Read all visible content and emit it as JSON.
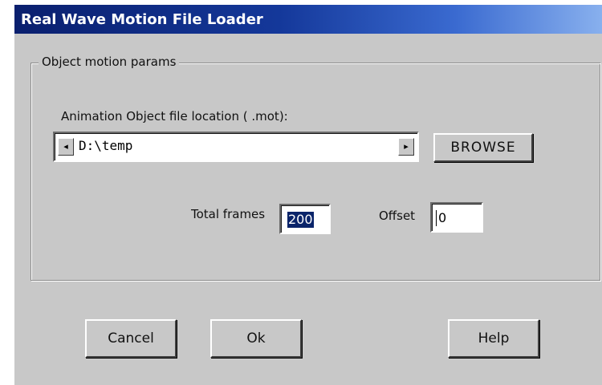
{
  "window": {
    "title": "Real Wave Motion File Loader"
  },
  "group": {
    "label": "Object motion params"
  },
  "file_location": {
    "label": "Animation Object file location ( .mot):",
    "value": "D:\\temp",
    "left_arrow": "◂",
    "right_arrow": "▸"
  },
  "buttons": {
    "browse": "BROWSE",
    "cancel": "Cancel",
    "ok": "Ok",
    "help": "Help"
  },
  "total_frames": {
    "label": "Total frames",
    "value": "200"
  },
  "offset": {
    "label": "Offset",
    "value": "0"
  },
  "colors": {
    "dialog_bg": "#c8c8c8",
    "titlebar_start": "#0a1f6e",
    "titlebar_end": "#88b0ee",
    "selection": "#0a246a"
  }
}
